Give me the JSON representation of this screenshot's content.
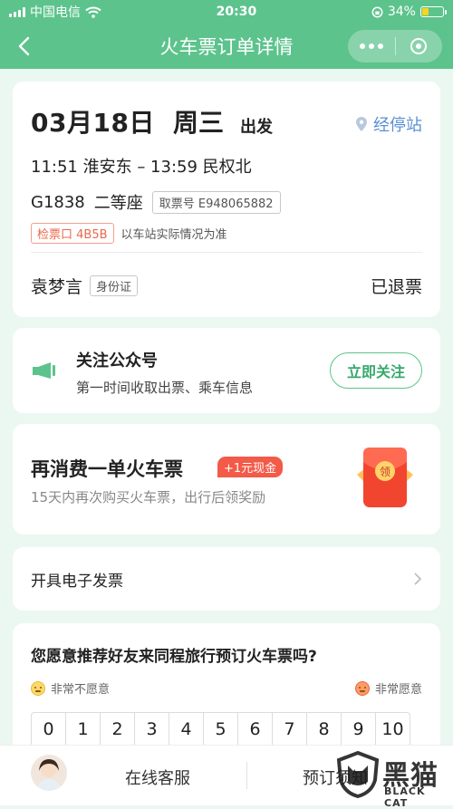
{
  "status_bar": {
    "carrier": "中国电信",
    "time": "20:30",
    "battery": "34%",
    "battery_level": 0.34,
    "battery_color": "#ffd21f"
  },
  "nav": {
    "title": "火车票订单详情"
  },
  "trip": {
    "date": "03月18日",
    "weekday": "周三",
    "depart_label": "出发",
    "stops_link": "经停站",
    "times": "11:51 淮安东 – 13:59 民权北",
    "train_no": "G1838",
    "seat": "二等座",
    "pickup_no": "取票号 E948065882",
    "gate": "检票口 4B5B",
    "gate_note": "以车站实际情况为准",
    "passenger": "袁梦言",
    "id_type": "身份证",
    "status": "已退票"
  },
  "follow": {
    "title": "关注公众号",
    "subtitle": "第一时间收取出票、乘车信息",
    "button": "立即关注"
  },
  "promo": {
    "title": "再消费一单火车票",
    "badge": "+1元现金",
    "subtitle": "15天内再次购买火车票，出行后领奖励",
    "packet_char": "领"
  },
  "invoice": {
    "label": "开具电子发票"
  },
  "survey": {
    "question": "您愿意推荐好友来同程旅行预订火车票吗?",
    "low_label": "非常不愿意",
    "high_label": "非常愿意",
    "scale": [
      "0",
      "1",
      "2",
      "3",
      "4",
      "5",
      "6",
      "7",
      "8",
      "9",
      "10"
    ]
  },
  "bottom": {
    "chat": "在线客服",
    "notice": "预订须知"
  },
  "watermark": {
    "text": "黑猫",
    "sub": "BLACK CAT"
  },
  "colors": {
    "brand": "#5cc38c",
    "link": "#5a8fd6",
    "alert": "#e9694d"
  }
}
